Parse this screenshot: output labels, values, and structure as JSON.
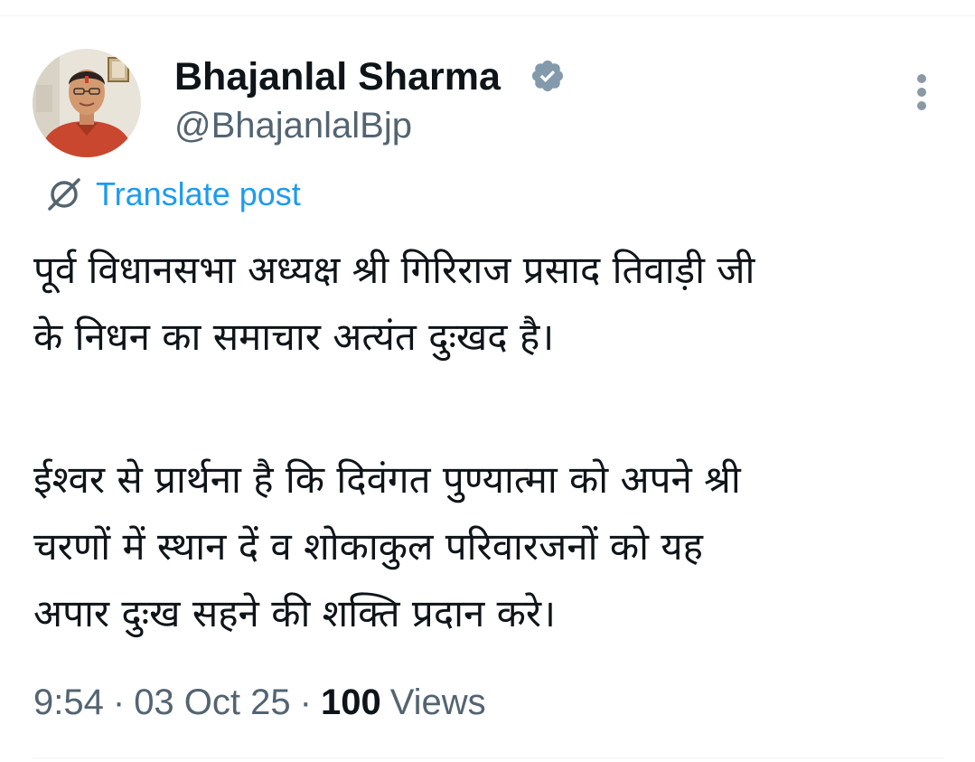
{
  "post": {
    "author": {
      "display_name": "Bhajanlal Sharma",
      "handle": "@BhajanlalBjp",
      "verified": true,
      "avatar_icon": "profile-photo"
    },
    "more_icon": "more-vertical-icon",
    "translate": {
      "icon": "translate-icon",
      "label": "Translate post"
    },
    "paragraphs": [
      {
        "lines": [
          "पूर्व विधानसभा अध्यक्ष श्री गिरिराज प्रसाद तिवाड़ी जी",
          "के निधन का समाचार अत्यंत दुःखद है।"
        ]
      },
      {
        "lines": [
          "ईश्वर से प्रार्थना है कि दिवंगत पुण्यात्मा को अपने श्री",
          "चरणों में स्थान दें व शोकाकुल परिवारजनों को यह",
          "अपार दुःख सहने की शक्ति प्रदान करे।"
        ]
      }
    ],
    "meta": {
      "time": "9:54",
      "date": "03 Oct 25",
      "separator": "·",
      "views_count": "100",
      "views_label": "Views"
    }
  },
  "colors": {
    "text_primary": "#0f1419",
    "text_secondary": "#536471",
    "link_blue": "#1d9bf0",
    "badge_gray": "#829aab",
    "divider": "#eff3f4"
  }
}
